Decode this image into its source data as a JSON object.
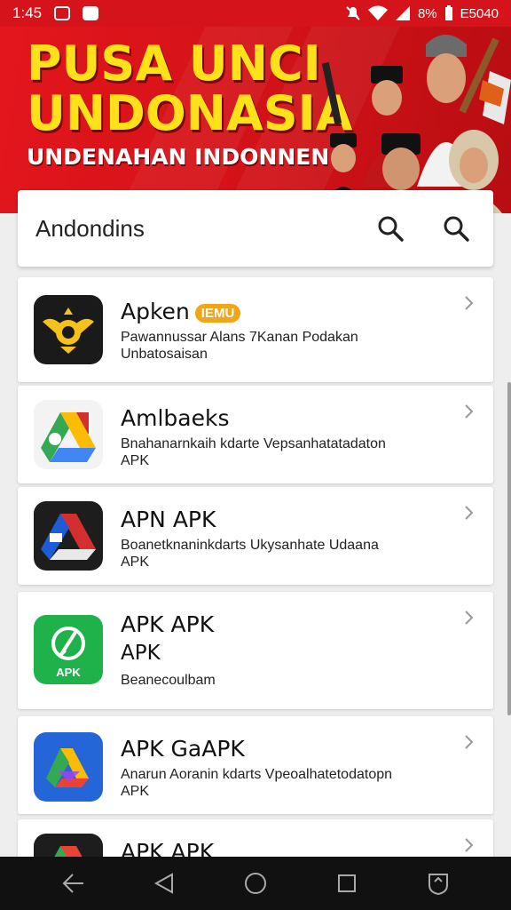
{
  "status_bar": {
    "time": "1:45",
    "battery_text": "8%",
    "right_text": "E5040",
    "icons": [
      "notification-icon",
      "app-icon",
      "mute-icon",
      "wifi-icon",
      "signal-icon",
      "battery-icon"
    ]
  },
  "banner": {
    "title_line1": "PUSA UNCI",
    "title_line2": "UNDONASIA",
    "subtitle": "UNDENAHAN INDONNEN",
    "colors": {
      "background": "#d4141a",
      "title": "#ffe11a"
    }
  },
  "search": {
    "value": "Andondins",
    "buttons": [
      "search-icon",
      "search-icon"
    ]
  },
  "apps": [
    {
      "title": "Apken",
      "badge": "IEMU",
      "desc_line1": "Pawannussar Alans 7Kanan Podakan",
      "desc_line2": "Unbatosaisan",
      "icon": "garuda-icon"
    },
    {
      "title": "Amlbaeks",
      "desc_line1": "Bnahanarnkaih kdarte Vepsanhatatadaton",
      "desc_line2": "APK",
      "icon": "drive-icon"
    },
    {
      "title": "APN APK",
      "desc_line1": "Boanetknaninkdarts Ukysanhate Udaana",
      "desc_line2": "APK",
      "icon": "drive-icon"
    },
    {
      "title": "APK APK",
      "subtitle": "APK",
      "desc_line1": "Beanecoulbam",
      "icon": "apk-installer-icon",
      "icon_label": "APK"
    },
    {
      "title": "APK GaAPK",
      "desc_line1": "Anarun Aoranin kdarts Vpeoalhatetodatopn",
      "desc_line2": "APK",
      "icon": "play-icon"
    },
    {
      "title": "APK APK",
      "icon": "drive-icon"
    }
  ],
  "navbar": {
    "buttons": [
      "back-arrow-icon",
      "back-triangle-icon",
      "home-circle-icon",
      "recents-square-icon",
      "shield-icon"
    ]
  }
}
